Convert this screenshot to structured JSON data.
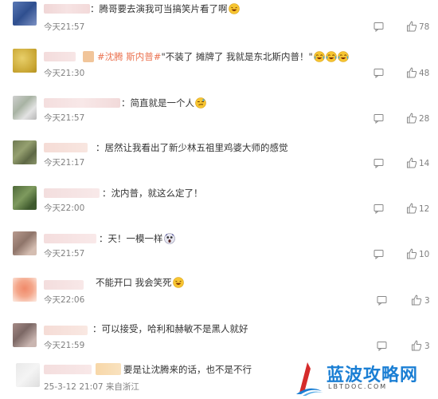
{
  "colors": {
    "topic": "#eb7350",
    "meta": "#808080",
    "logo": "#1b7fd4"
  },
  "comments": [
    {
      "text": "：腾哥要去演我可当搞笑片看了啊",
      "topic": "",
      "emoji": [
        "laugh"
      ],
      "time": "今天21:57",
      "likes": "78"
    },
    {
      "text": "\"不装了 摊牌了 我就是东北斯内普！\"",
      "topic": "#沈腾 斯内普#",
      "emoji": [
        "cry-laugh",
        "cry-laugh",
        "cry-laugh"
      ],
      "time": "今天21:30",
      "likes": "48"
    },
    {
      "text": "：简直就是一个人",
      "topic": "",
      "emoji": [
        "smirk"
      ],
      "time": "今天21:57",
      "likes": "28"
    },
    {
      "text": "：居然让我看出了新少林五祖里鸡婆大师的感觉",
      "topic": "",
      "emoji": [],
      "time": "今天21:17",
      "likes": "14"
    },
    {
      "text": "：沈内普，就这么定了！",
      "topic": "",
      "emoji": [],
      "time": "今天22:00",
      "likes": "12"
    },
    {
      "text": "：天！一模一样",
      "topic": "",
      "emoji": [
        "shock"
      ],
      "time": "今天21:57",
      "likes": "10"
    },
    {
      "text": "不能开口 我会笑死",
      "topic": "",
      "emoji": [
        "laugh"
      ],
      "time": "今天22:06",
      "likes": "3"
    },
    {
      "text": "：可以接受，哈利和赫敏不是黑人就好",
      "topic": "",
      "emoji": [],
      "time": "今天21:59",
      "likes": "3"
    },
    {
      "text": "要是让沈腾来的话，也不是不行",
      "topic": "",
      "emoji": [],
      "time": "25-3-12 21:07 来自浙江",
      "likes": ""
    }
  ],
  "watermark": {
    "title": "蓝波攻略网",
    "url": "LBTDOC.COM"
  }
}
